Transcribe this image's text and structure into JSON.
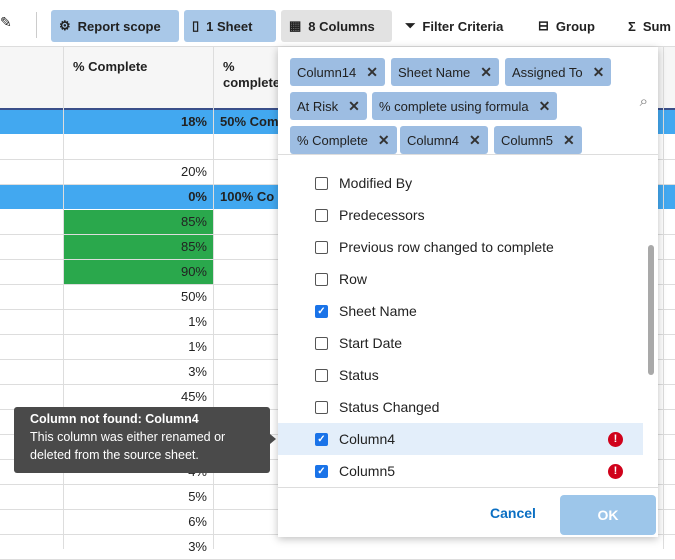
{
  "toolbar": {
    "items": [
      {
        "label": "Report scope",
        "icon": "gear-icon"
      },
      {
        "label": "1 Sheet",
        "icon": "sheet-icon"
      },
      {
        "label": "8 Columns",
        "icon": "columns-icon"
      },
      {
        "label": "Filter Criteria",
        "icon": "filter-icon"
      },
      {
        "label": "Group",
        "icon": "group-icon"
      },
      {
        "label": "Sum",
        "icon": "sigma-icon"
      }
    ]
  },
  "grid": {
    "headers": [
      "% Complete",
      "% complete using formula"
    ],
    "rows": [
      {
        "pct": "18%",
        "formula": "50% Com",
        "style": "blue"
      },
      {
        "pct": "",
        "formula": "",
        "style": ""
      },
      {
        "pct": "20%",
        "formula": "",
        "style": ""
      },
      {
        "pct": "0%",
        "formula": "100% Co",
        "style": "blue"
      },
      {
        "pct": "85%",
        "formula": "",
        "style": "green"
      },
      {
        "pct": "85%",
        "formula": "",
        "style": "green"
      },
      {
        "pct": "90%",
        "formula": "",
        "style": "green"
      },
      {
        "pct": "50%",
        "formula": "",
        "style": ""
      },
      {
        "pct": "1%",
        "formula": "",
        "style": ""
      },
      {
        "pct": "1%",
        "formula": "",
        "style": ""
      },
      {
        "pct": "3%",
        "formula": "",
        "style": ""
      },
      {
        "pct": "45%",
        "formula": "",
        "style": ""
      },
      {
        "pct": "",
        "formula": "",
        "style": ""
      },
      {
        "pct": "",
        "formula": "",
        "style": ""
      },
      {
        "pct": "4%",
        "formula": "",
        "style": ""
      },
      {
        "pct": "5%",
        "formula": "",
        "style": ""
      },
      {
        "pct": "6%",
        "formula": "",
        "style": ""
      },
      {
        "pct": "3%",
        "formula": "",
        "style": ""
      }
    ]
  },
  "dialog": {
    "chips": [
      "Column14",
      "Sheet Name",
      "Assigned To",
      "At Risk",
      "% complete using formula",
      "% Complete",
      "Column4",
      "Column5"
    ],
    "items": [
      {
        "label": "Modified By",
        "checked": false
      },
      {
        "label": "Predecessors",
        "checked": false
      },
      {
        "label": "Previous row changed to complete",
        "checked": false
      },
      {
        "label": "Row",
        "checked": false
      },
      {
        "label": "Sheet Name",
        "checked": true
      },
      {
        "label": "Start Date",
        "checked": false
      },
      {
        "label": "Status",
        "checked": false
      },
      {
        "label": "Status Changed",
        "checked": false
      },
      {
        "label": "Column4",
        "checked": true,
        "error": true,
        "highlighted": true
      },
      {
        "label": "Column5",
        "checked": true,
        "error": true
      }
    ],
    "cancel": "Cancel",
    "ok": "OK"
  },
  "tooltip": {
    "title": "Column not found: Column4",
    "body": "This column was either renamed or deleted from the source sheet."
  },
  "colors": {
    "selected_row": "#42a8f0",
    "green": "#2aa84c",
    "chip": "#9dbde2",
    "error": "#d0021b",
    "accent": "#1a73e8"
  }
}
